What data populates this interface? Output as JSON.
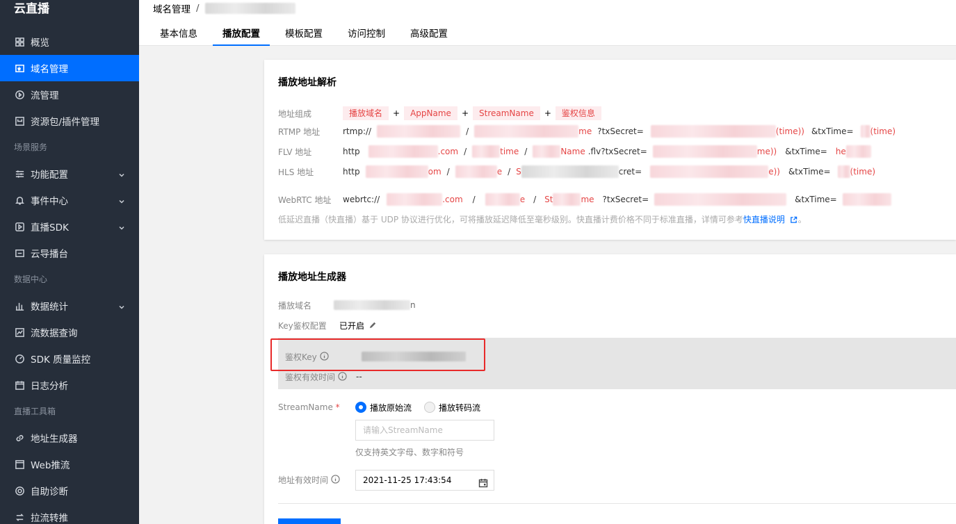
{
  "sidebar": {
    "brand": "云直播",
    "items_top": [
      {
        "label": "概览",
        "icon": "grid-icon"
      },
      {
        "label": "域名管理",
        "icon": "domain-icon",
        "active": true
      },
      {
        "label": "流管理",
        "icon": "stream-icon"
      },
      {
        "label": "资源包/插件管理",
        "icon": "package-icon"
      }
    ],
    "group1_title": "场景服务",
    "items_group1": [
      {
        "label": "功能配置",
        "icon": "sliders-icon"
      },
      {
        "label": "事件中心",
        "icon": "bell-icon"
      },
      {
        "label": "直播SDK",
        "icon": "play-icon"
      },
      {
        "label": "云导播台",
        "icon": "monitor-icon"
      }
    ],
    "group2_title": "数据中心",
    "items_group2": [
      {
        "label": "数据统计",
        "icon": "bar-chart-icon"
      },
      {
        "label": "流数据查询",
        "icon": "line-chart-icon"
      },
      {
        "label": "SDK 质量监控",
        "icon": "gauge-icon"
      },
      {
        "label": "日志分析",
        "icon": "calendar-icon"
      }
    ],
    "group3_title": "直播工具箱",
    "items_group3": [
      {
        "label": "地址生成器",
        "icon": "link-icon"
      },
      {
        "label": "Web推流",
        "icon": "web-icon"
      },
      {
        "label": "自助诊断",
        "icon": "diagnose-icon"
      },
      {
        "label": "拉流转推",
        "icon": "relay-icon"
      }
    ]
  },
  "header": {
    "breadcrumb_root": "域名管理",
    "breadcrumb_sep": "/",
    "tabs": [
      "基本信息",
      "播放配置",
      "模板配置",
      "访问控制",
      "高级配置"
    ],
    "active_tab": 1
  },
  "parse_panel": {
    "title": "播放地址解析",
    "compose_label": "地址组成",
    "compose_tags": [
      "播放域名",
      "AppName",
      "StreamName",
      "鉴权信息"
    ],
    "plus": "+",
    "rows": [
      {
        "label": "RTMP 地址",
        "prefix": "rtmp://",
        "sep1": "/",
        "secret": "?txSecret=",
        "time": "&txTime="
      },
      {
        "label": "FLV 地址",
        "prefix": "http",
        "sep1": "/",
        "sep2": "/",
        "secret": ".flv?txSecret=",
        "time": "&txTime="
      },
      {
        "label": "HLS 地址",
        "prefix": "http",
        "sep1": "/",
        "sep2": "/",
        "secret": "cret=",
        "time": "&txTime="
      },
      {
        "label": "WebRTC 地址",
        "prefix": "webrtc://",
        "domain_tail": ".com",
        "sep1": "/",
        "sep2": "/",
        "secret": "?txSecret=",
        "time": "&txTime="
      }
    ],
    "frag_flv_domain": ".com",
    "frag_flv_app": "time",
    "frag_flv_stream": "Name",
    "frag_flv_secret": "me))",
    "frag_flv_time": "he",
    "frag_rtmp_stream": "me",
    "frag_rtmp_secret": "(time))",
    "frag_rtmp_time": "(time)",
    "frag_hls_domain": "om",
    "frag_hls_app": "e",
    "frag_hls_stream": "S",
    "frag_hls_secret": "e))",
    "frag_hls_time": "(time)",
    "frag_webrtc_app": "e",
    "frag_webrtc_stream1": "St",
    "frag_webrtc_stream2": "me",
    "note_text": "低延迟直播（快直播）基于 UDP 协议进行优化，可将播放延迟降低至毫秒级别。快直播计费价格不同于标准直播，详情可参考",
    "note_link": "快直播说明",
    "note_end": "。"
  },
  "generator_panel": {
    "title": "播放地址生成器",
    "domain_label": "播放域名",
    "domain_tail": "n",
    "key_config_label": "Key鉴权配置",
    "key_config_value": "已开启",
    "auth_key_label": "鉴权Key",
    "auth_validity_label": "鉴权有效时间",
    "auth_validity_value": "--",
    "stream_name_label": "StreamName",
    "required_mark": "*",
    "radio_original": "播放原始流",
    "radio_transcode": "播放转码流",
    "stream_input_placeholder": "请输入StreamName",
    "stream_hint": "仅支持英文字母、数字和符号",
    "expire_label": "地址有效时间",
    "expire_value": "2021-11-25 17:43:54"
  },
  "colors": {
    "sidebar_bg": "#262e3a",
    "accent": "#006eff",
    "tag_bg": "#fdecee",
    "tag_text": "#e54545",
    "highlight_box": "#e82a2a"
  }
}
